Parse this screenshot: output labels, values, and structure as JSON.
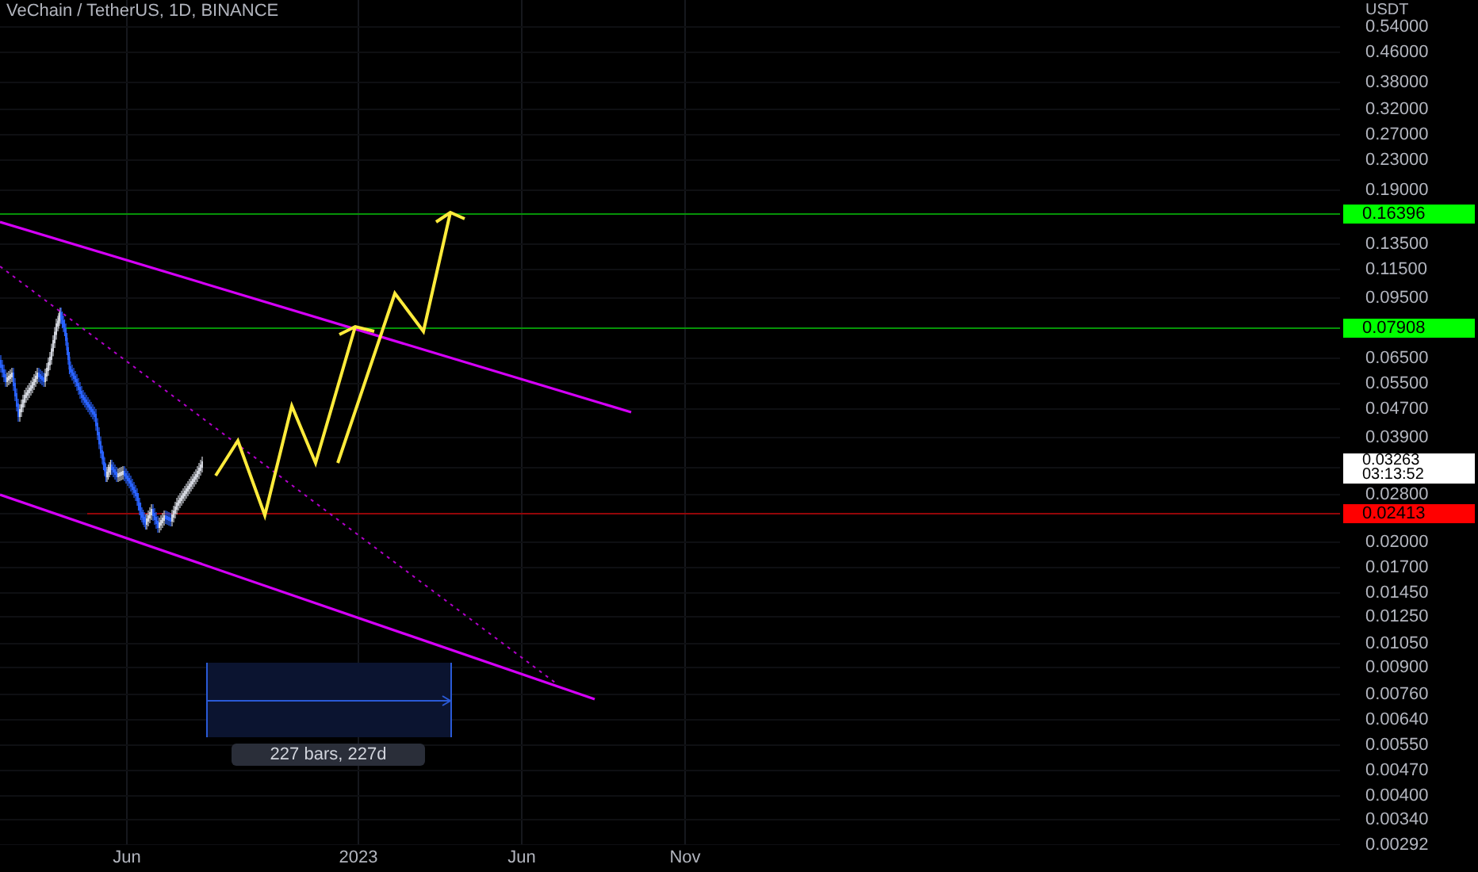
{
  "chart": {
    "title": "VeChain / TetherUS, 1D, BINANCE",
    "measure": {
      "label": "227 bars, 227d"
    },
    "time_axis": [
      "Jun",
      "2023",
      "Jun",
      "Nov"
    ],
    "price_axis": {
      "unit": "USDT",
      "labels": [
        {
          "kind": "tick",
          "text": "0.54000"
        },
        {
          "kind": "tick",
          "text": "0.46000"
        },
        {
          "kind": "tick",
          "text": "0.38000"
        },
        {
          "kind": "tick",
          "text": "0.32000"
        },
        {
          "kind": "tick",
          "text": "0.27000"
        },
        {
          "kind": "tick",
          "text": "0.23000"
        },
        {
          "kind": "tick",
          "text": "0.19000"
        },
        {
          "kind": "tag",
          "text": "0.16396",
          "color": "#00ff00"
        },
        {
          "kind": "tick",
          "text": "0.13500"
        },
        {
          "kind": "tick",
          "text": "0.11500"
        },
        {
          "kind": "tick",
          "text": "0.09500"
        },
        {
          "kind": "tag",
          "text": "0.07908",
          "color": "#00ff00"
        },
        {
          "kind": "tick",
          "text": "0.06500"
        },
        {
          "kind": "tick",
          "text": "0.05500"
        },
        {
          "kind": "tick",
          "text": "0.04700"
        },
        {
          "kind": "tick",
          "text": "0.03900"
        },
        {
          "kind": "last",
          "text": "0.03263",
          "countdown": "03:13:52",
          "color": "#ffffff"
        },
        {
          "kind": "tick",
          "text": "0.02800"
        },
        {
          "kind": "tag",
          "text": "0.02413",
          "color": "#ff0000"
        },
        {
          "kind": "tick",
          "text": "0.02000"
        },
        {
          "kind": "tick",
          "text": "0.01700"
        },
        {
          "kind": "tick",
          "text": "0.01450"
        },
        {
          "kind": "tick",
          "text": "0.01250"
        },
        {
          "kind": "tick",
          "text": "0.01050"
        },
        {
          "kind": "tick",
          "text": "0.00900"
        },
        {
          "kind": "tick",
          "text": "0.00760"
        },
        {
          "kind": "tick",
          "text": "0.00640"
        },
        {
          "kind": "tick",
          "text": "0.00550"
        },
        {
          "kind": "tick",
          "text": "0.00470"
        },
        {
          "kind": "tick",
          "text": "0.00400"
        },
        {
          "kind": "tick",
          "text": "0.00340"
        },
        {
          "kind": "tick",
          "text": "0.00292"
        }
      ]
    }
  }
}
